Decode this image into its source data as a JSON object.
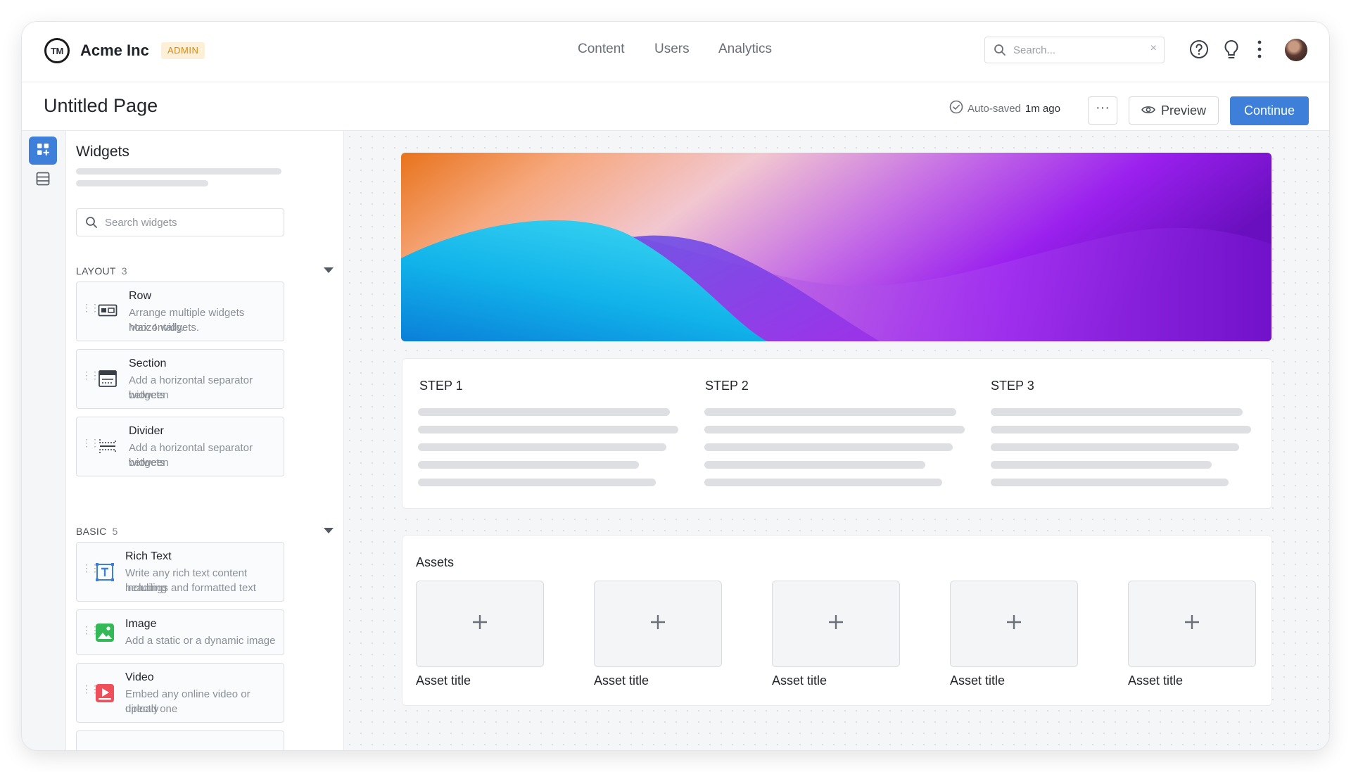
{
  "brand": {
    "logo_text": "TM",
    "name": "Acme Inc",
    "badge": "ADMIN"
  },
  "nav": {
    "items": [
      "Content",
      "Users",
      "Analytics"
    ]
  },
  "search": {
    "placeholder": "Search...",
    "clear": "×"
  },
  "page": {
    "title": "Untitled Page",
    "autosave_prefix": "Auto-saved",
    "autosave_time": "1m ago",
    "more": "···",
    "preview": "Preview",
    "continue": "Continue"
  },
  "widgets": {
    "title": "Widgets",
    "search_placeholder": "Search widgets",
    "sections": [
      {
        "name": "LAYOUT",
        "count": "3",
        "items": [
          {
            "title": "Row",
            "desc_1": "Arrange multiple widgets horizontally.",
            "desc_2": "Max 4 widgets.",
            "icon": "row-icon"
          },
          {
            "title": "Section",
            "desc_1": "Add a horizontal separator between",
            "desc_2": "widgets",
            "icon": "section-icon"
          },
          {
            "title": "Divider",
            "desc_1": "Add a horizontal separator between",
            "desc_2": "widgets",
            "icon": "divider-icon"
          }
        ]
      },
      {
        "name": "BASIC",
        "count": "5",
        "items": [
          {
            "title": "Rich Text",
            "desc_1": "Write any rich text content including",
            "desc_2": "headings and formatted text",
            "icon": "rich-text-icon"
          },
          {
            "title": "Image",
            "desc_1": "Add a static or a dynamic image",
            "desc_2": "",
            "icon": "image-icon"
          },
          {
            "title": "Video",
            "desc_1": "Embed any online video or upload one",
            "desc_2": "directly",
            "icon": "video-icon"
          }
        ]
      }
    ]
  },
  "steps": [
    "STEP 1",
    "STEP 2",
    "STEP 3"
  ],
  "assets": {
    "title": "Assets",
    "items": [
      "Asset title",
      "Asset title",
      "Asset title",
      "Asset title",
      "Asset title"
    ],
    "add_symbol": "+"
  },
  "colors": {
    "accent": "#3d7fd9",
    "admin_badge_bg": "#fdf0d6",
    "admin_badge_text": "#d58a1b"
  }
}
